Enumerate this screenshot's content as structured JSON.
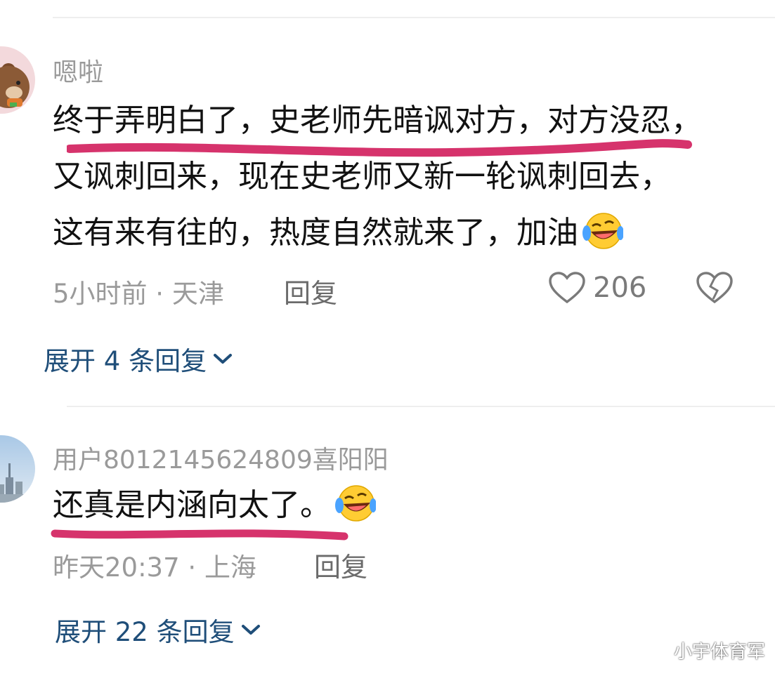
{
  "comments": [
    {
      "username": "嗯啦",
      "text_lines": [
        "终于弄明白了，史老师先暗讽对方，对方没忍，",
        "又讽刺回来，现在史老师又新一轮讽刺回去，",
        "这有来有往的，热度自然就来了，加油"
      ],
      "emoji": "laughing-crying-face",
      "time": "5小时前",
      "location": "天津",
      "meta_separator": " · ",
      "reply_label": "回复",
      "like_count": "206",
      "expand_label": "展开 4 条回复"
    },
    {
      "username": "用户8012145624809喜阳阳",
      "text_lines": [
        "还真是内涵向太了。"
      ],
      "emoji": "laughing-crying-face",
      "time": "昨天20:37",
      "location": "上海",
      "meta_separator": " · ",
      "reply_label": "回复",
      "expand_label": "展开 22 条回复"
    }
  ],
  "watermark": "小宇体育军",
  "colors": {
    "accent_link": "#1f4e79",
    "highlight_marker": "#d6336c",
    "muted_text": "#9a9a9a"
  }
}
